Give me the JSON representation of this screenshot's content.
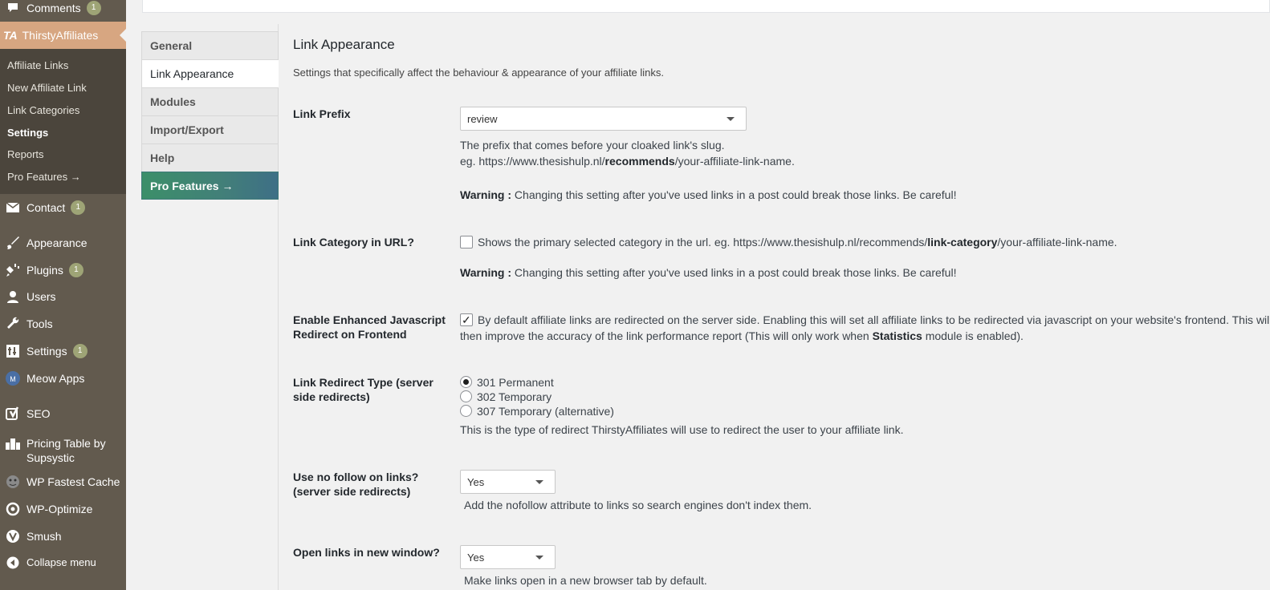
{
  "sidebar": {
    "comments": {
      "label": "Comments",
      "badge": "1"
    },
    "thirsty": {
      "label": "ThirstyAffiliates",
      "logo": "TA"
    },
    "submenu": [
      "Affiliate Links",
      "New Affiliate Link",
      "Link Categories",
      "Settings",
      "Reports",
      "Pro Features →"
    ],
    "contact": {
      "label": "Contact",
      "badge": "1"
    },
    "appearance": "Appearance",
    "plugins": {
      "label": "Plugins",
      "badge": "1"
    },
    "users": "Users",
    "tools": "Tools",
    "settings": {
      "label": "Settings",
      "badge": "1"
    },
    "meow": "Meow Apps",
    "seo": "SEO",
    "pricing": "Pricing Table by Supsystic",
    "wpfc": "WP Fastest Cache",
    "wpopt": "WP-Optimize",
    "smush": "Smush",
    "collapse": "Collapse menu"
  },
  "tabs": [
    "General",
    "Link Appearance",
    "Modules",
    "Import/Export",
    "Help",
    "Pro Features →"
  ],
  "main": {
    "title": "Link Appearance",
    "description": "Settings that specifically affect the behaviour & appearance of your affiliate links.",
    "prefix": {
      "label": "Link Prefix",
      "value": "review",
      "help1": "The prefix that comes before your cloaked link's slug.",
      "help2_pre": "eg. https://www.thesishulp.nl/",
      "help2_bold": "recommends",
      "help2_post": "/your-affiliate-link-name.",
      "warn_label": "Warning :",
      "warn_text": "Changing this setting after you've used links in a post could break those links. Be careful!"
    },
    "category": {
      "label": "Link Category in URL?",
      "text_pre": "Shows the primary selected category in the url. eg. https://www.thesishulp.nl/recommends/",
      "text_bold": "link-category",
      "text_post": "/your-affiliate-link-name.",
      "warn_label": "Warning :",
      "warn_text": "Changing this setting after you've used links in a post could break those links. Be careful!"
    },
    "js": {
      "label": "Enable Enhanced Javascript Redirect on Frontend",
      "text_line1": "By default affiliate links are redirected on the server side. Enabling this will set all affiliate links to be redirected via javascript on your website's frontend. This will",
      "text_line2_pre": "then improve the accuracy of the link performance report (This will only work when ",
      "text_bold": "Statistics",
      "text_line2_post": " module is enabled)."
    },
    "redirect": {
      "label": "Link Redirect Type (server side redirects)",
      "options": [
        "301 Permanent",
        "302 Temporary",
        "307 Temporary (alternative)"
      ],
      "help": "This is the type of redirect ThirstyAffiliates will use to redirect the user to your affiliate link."
    },
    "nofollow": {
      "label": "Use no follow on links? (server side redirects)",
      "value": "Yes",
      "help": "Add the nofollow attribute to links so search engines don't index them."
    },
    "newwindow": {
      "label": "Open links in new window?",
      "value": "Yes",
      "help": "Make links open in a new browser tab by default."
    }
  }
}
